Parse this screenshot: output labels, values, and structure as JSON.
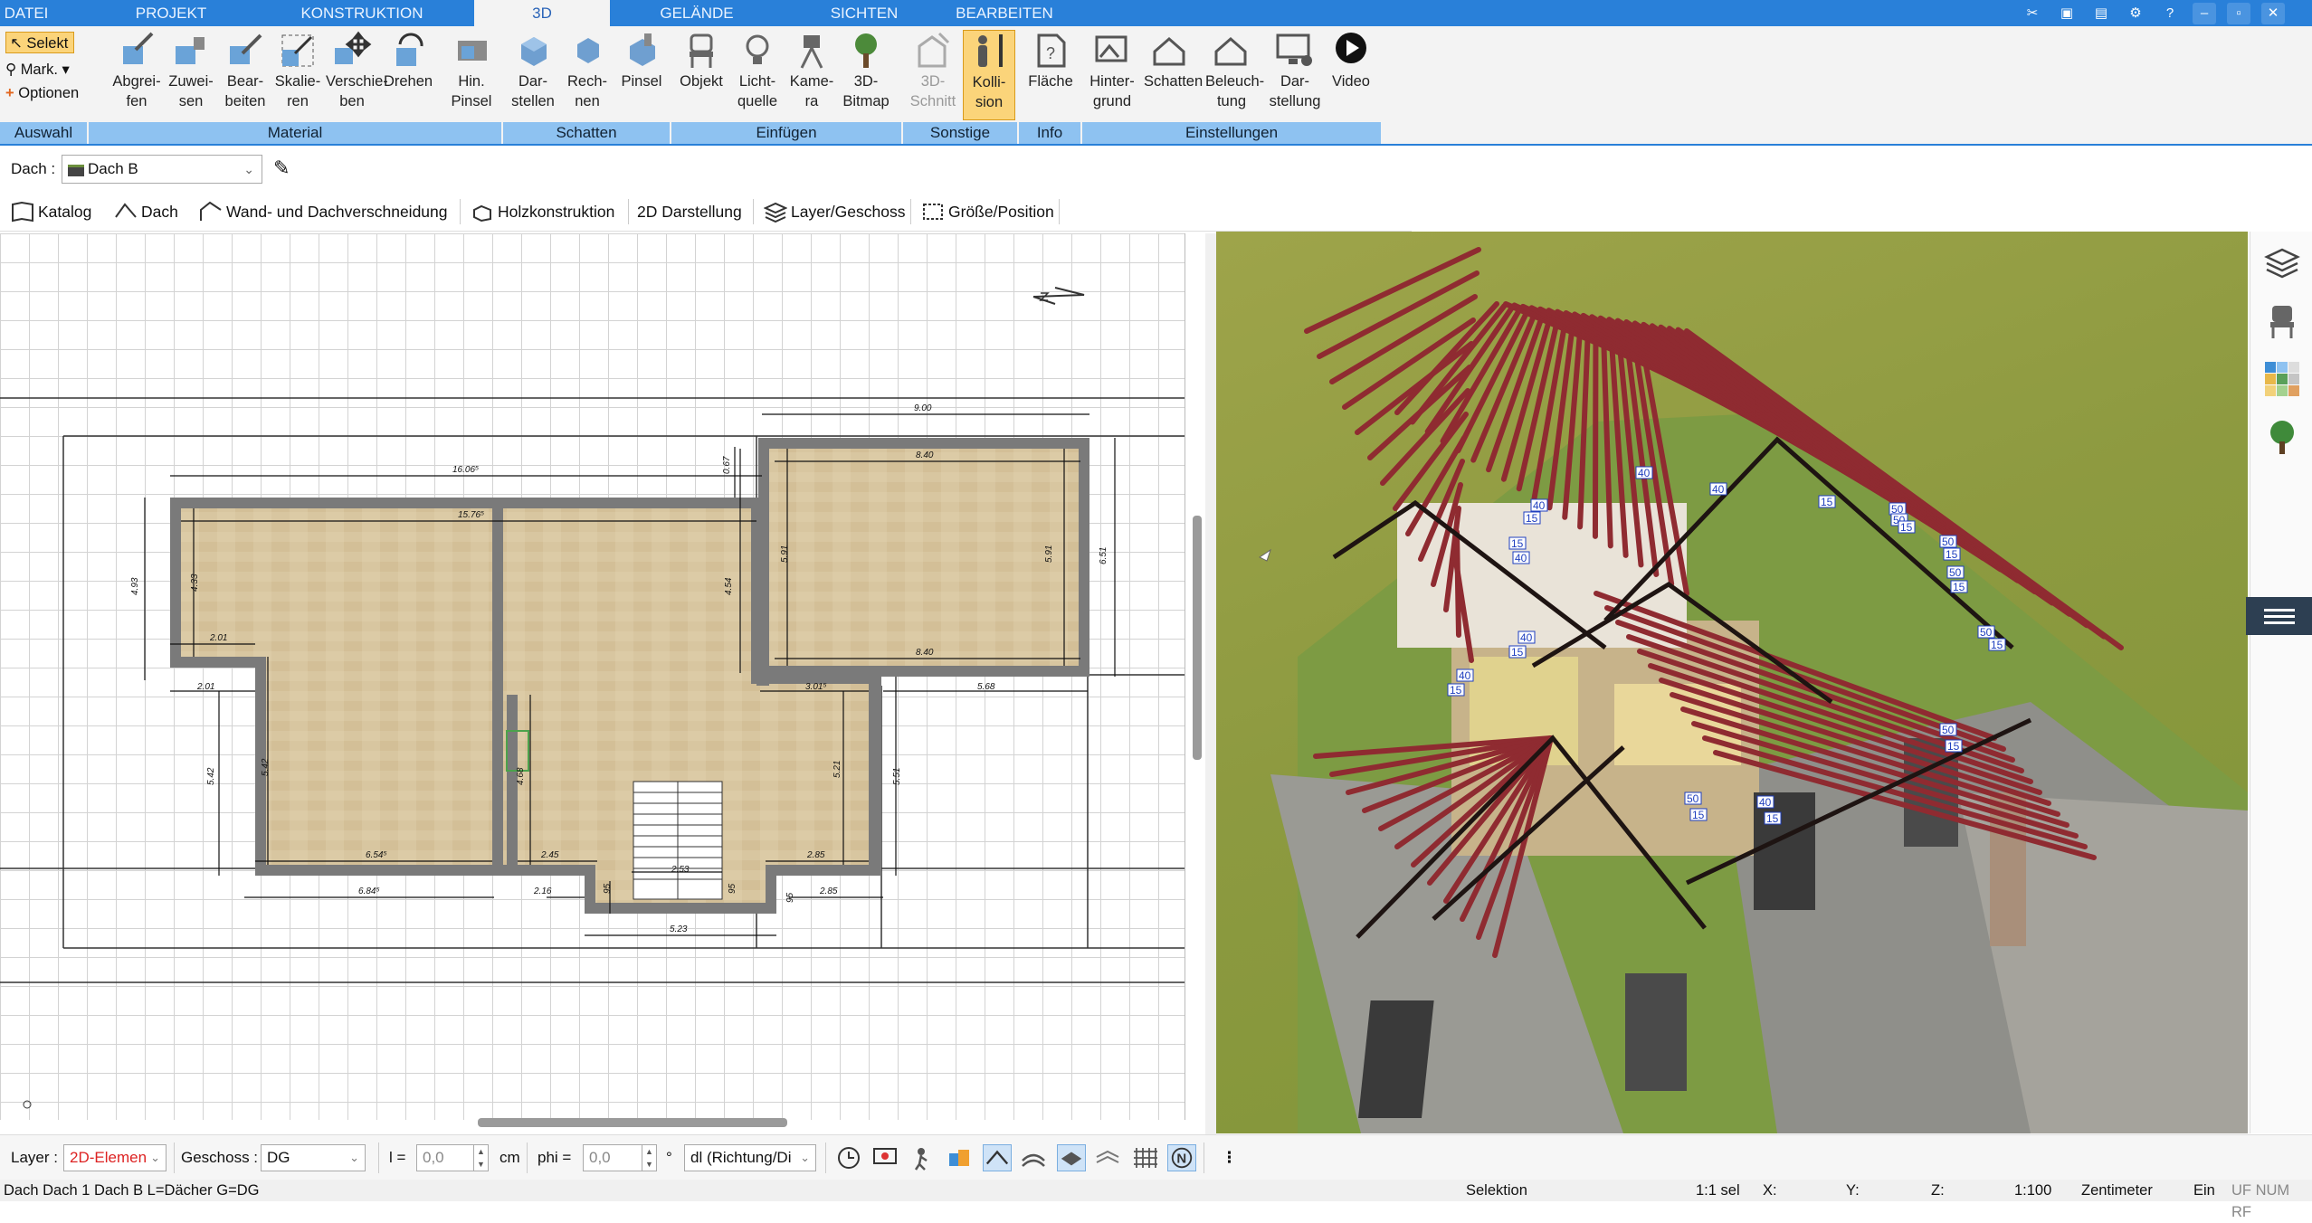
{
  "menu_tabs": [
    "DATEI",
    "PROJEKT",
    "KONSTRUKTION",
    "3D",
    "GELÄNDE",
    "SICHTEN",
    "BEARBEITEN"
  ],
  "active_tab": "3D",
  "window_buttons": [
    "tools-icon",
    "restore-icon",
    "copy-icon",
    "settings-icon",
    "help-icon",
    "minimize-icon",
    "maximize-icon",
    "close-icon"
  ],
  "ribbon": {
    "auswahl": {
      "title": "Auswahl",
      "selekt": "Selekt",
      "mark": "Mark.",
      "optionen": "Optionen"
    },
    "material": {
      "title": "Material",
      "buttons": [
        "Abgrei-\nfen",
        "Zuwei-\nsen",
        "Bear-\nbeiten",
        "Skalie-\nren",
        "Verschie-\nben",
        "Drehen",
        "Hin.\nPinsel"
      ]
    },
    "schatten": {
      "title": "Schatten",
      "buttons": [
        "Dar-\nstellen",
        "Rech-\nnen",
        "Pinsel"
      ]
    },
    "einfuegen": {
      "title": "Einfügen",
      "buttons": [
        "Objekt",
        "Licht-\nquelle",
        "Kame-\nra",
        "3D-\nBitmap"
      ]
    },
    "sonstige": {
      "title": "Sonstige",
      "buttons": [
        "3D-\nSchnitt",
        "Kolli-\nsion"
      ]
    },
    "info": {
      "title": "Info",
      "buttons": [
        "Fläche"
      ]
    },
    "einstellungen": {
      "title": "Einstellungen",
      "buttons": [
        "Hinter-\ngrund",
        "Schatten",
        "Beleuch-\ntung",
        "Dar-\nstellung",
        "Video"
      ]
    }
  },
  "object_row": {
    "label": "Dach :",
    "selected": "Dach B"
  },
  "toolbar": [
    "Katalog",
    "Dach",
    "Wand- und Dachverschneidung",
    "Holzkonstruktion",
    "2D Darstellung",
    "Layer/Geschoss",
    "Größe/Position"
  ],
  "plan_dimensions": {
    "top_total": "9.00",
    "top_left": "16.06⁵",
    "inner_left_top": "15.76⁵",
    "top_right": "8.40",
    "top_right_inner": "8.40",
    "left_outer": "4.93",
    "left_inner": "4.33",
    "left_ledge": "2.01",
    "left_ledge2": "2.01",
    "mid_a": "4.54",
    "right_a": "5.91",
    "right_b": "5.91",
    "right_outer": "6.51",
    "notch": "0.67",
    "mid_right": "3.01⁵",
    "right_c": "5.68",
    "left_c": "5.42",
    "left_d": "5.42",
    "stair": "4.68",
    "right_d": "5.21",
    "right_e": "5.51",
    "bot_a": "6.54⁵",
    "bot_b": "2.45",
    "bot_c": "2.85",
    "bot_d": "6.84⁵",
    "bot_e": "2.16",
    "bot_f": "2.85",
    "bot_g": "5.23",
    "bot_h": "2.53",
    "bot_95a": "95",
    "bot_95b": "95",
    "bot_95c": "95"
  },
  "view3d_labels": [
    "40",
    "40",
    "40",
    "15",
    "15",
    "40",
    "15",
    "50",
    "50",
    "15",
    "50",
    "15",
    "50",
    "15",
    "40",
    "15",
    "50",
    "15",
    "40",
    "15",
    "50",
    "15",
    "40",
    "15",
    "50",
    "15"
  ],
  "bottom_controls": {
    "layer_label": "Layer :",
    "layer_value": "2D-Elemen",
    "geschoss_label": "Geschoss :",
    "geschoss_value": "DG",
    "l_label": "l =",
    "l_value": "0,0",
    "l_unit": "cm",
    "phi_label": "phi =",
    "phi_value": "0,0",
    "phi_unit": "°",
    "dir_value": "dl (Richtung/Di"
  },
  "status": {
    "left": "Dach Dach 1 Dach B L=Dächer G=DG",
    "mode": "Selektion",
    "sel": "1:1 sel",
    "x": "X:",
    "y": "Y:",
    "z": "Z:",
    "scale": "1:100",
    "unit": "Zentimeter",
    "ein": "Ein",
    "flags": "UF NUM RF"
  },
  "colors": {
    "accent": "#2980d9",
    "ribbon_group": "#8ec2f1",
    "pressed": "#fbd47a",
    "rafter": "#9b2f36",
    "grass": "#8d9a40",
    "floor": "#d8c6a0"
  }
}
